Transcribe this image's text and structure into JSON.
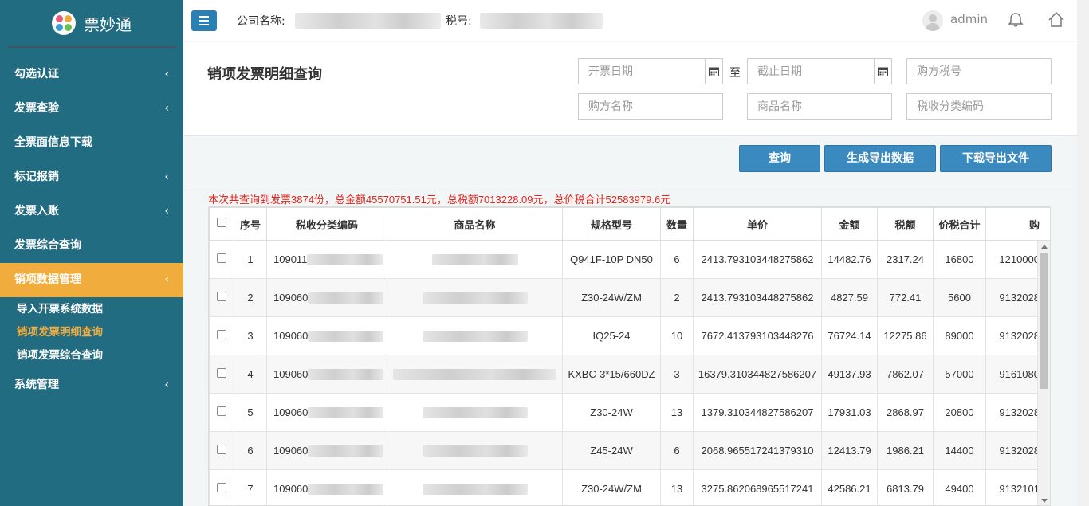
{
  "app": {
    "name": "票妙通"
  },
  "sidebar": {
    "items": [
      {
        "label": "勾选认证",
        "chevron": "‹"
      },
      {
        "label": "发票查验",
        "chevron": "‹"
      },
      {
        "label": "全票面信息下载",
        "chevron": ""
      },
      {
        "label": "标记报销",
        "chevron": "‹"
      },
      {
        "label": "发票入账",
        "chevron": "‹"
      },
      {
        "label": "发票综合查询",
        "chevron": ""
      },
      {
        "label": "销项数据管理",
        "chevron": "‹"
      }
    ],
    "sub_items": [
      {
        "label": "导入开票系统数据"
      },
      {
        "label": "销项发票明细查询"
      },
      {
        "label": "销项发票综合查询"
      }
    ],
    "after": {
      "label": "系统管理",
      "chevron": "‹"
    },
    "active_color": "#f0ac3c",
    "bg_color": "#226c82"
  },
  "header": {
    "company_label": "公司名称:",
    "tax_label": "税号:",
    "user": "admin",
    "icons": [
      "menu-icon",
      "avatar",
      "bell-icon",
      "home-icon"
    ]
  },
  "filters": {
    "title": "销项发票明细查询",
    "start_date_placeholder": "开票日期",
    "to_label": "至",
    "end_date_placeholder": "截止日期",
    "buyer_tax_placeholder": "购方税号",
    "buyer_name_placeholder": "购方名称",
    "product_placeholder": "商品名称",
    "tax_code_placeholder": "税收分类编码"
  },
  "actions": {
    "query": "查询",
    "generate": "生成导出数据",
    "download": "下载导出文件"
  },
  "summary": "本次共查询到发票3874份，总金额45570751.51元，总税额7013228.09元，总价税合计52583979.6元",
  "table": {
    "columns": [
      "序号",
      "税收分类编码",
      "商品名称",
      "规格型号",
      "数量",
      "单价",
      "金额",
      "税额",
      "价税合计",
      "购"
    ],
    "rows": [
      {
        "no": "1",
        "code": "109011",
        "spec": "Q941F-10P DN50",
        "qty": "6",
        "price": "2413.793103448275862",
        "amount": "14482.76",
        "tax": "2317.24",
        "total": "16800",
        "buyer": "1210000"
      },
      {
        "no": "2",
        "code": "109060",
        "spec": "Z30-24W/ZM",
        "qty": "2",
        "price": "2413.793103448275862",
        "amount": "4827.59",
        "tax": "772.41",
        "total": "5600",
        "buyer": "9132028"
      },
      {
        "no": "3",
        "code": "109060",
        "spec": "IQ25-24",
        "qty": "10",
        "price": "7672.413793103448276",
        "amount": "76724.14",
        "tax": "12275.86",
        "total": "89000",
        "buyer": "9132028"
      },
      {
        "no": "4",
        "code": "109060",
        "spec": "KXBC-3*15/660DZ",
        "qty": "3",
        "price": "16379.310344827586207",
        "amount": "49137.93",
        "tax": "7862.07",
        "total": "57000",
        "buyer": "9161080"
      },
      {
        "no": "5",
        "code": "109060",
        "spec": "Z30-24W",
        "qty": "13",
        "price": "1379.310344827586207",
        "amount": "17931.03",
        "tax": "2868.97",
        "total": "20800",
        "buyer": "9132028"
      },
      {
        "no": "6",
        "code": "109060",
        "spec": "Z45-24W",
        "qty": "6",
        "price": "2068.965517241379310",
        "amount": "12413.79",
        "tax": "1986.21",
        "total": "14400",
        "buyer": "9132028"
      },
      {
        "no": "7",
        "code": "109060",
        "spec": "Z30-24W/ZM",
        "qty": "13",
        "price": "3275.862068965517241",
        "amount": "42586.21",
        "tax": "6813.79",
        "total": "49400",
        "buyer": "9132101"
      }
    ]
  }
}
